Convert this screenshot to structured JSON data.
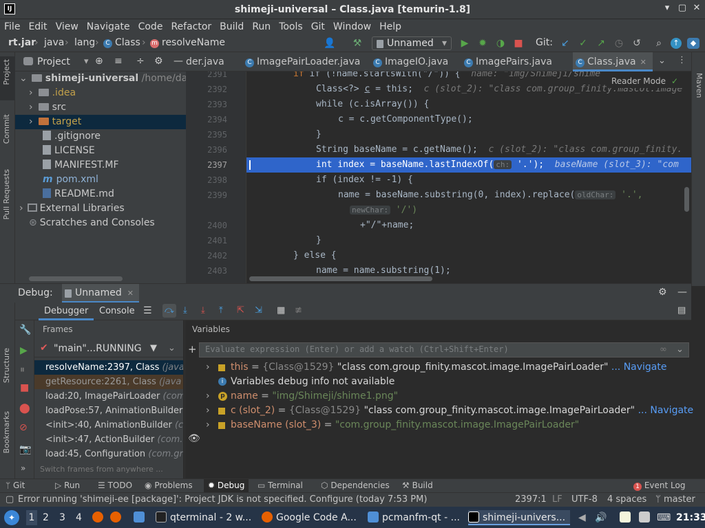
{
  "window": {
    "title": "shimeji-universal – Class.java [temurin-1.8]",
    "app_icon": "IJ"
  },
  "menu": [
    "File",
    "Edit",
    "View",
    "Navigate",
    "Code",
    "Refactor",
    "Build",
    "Run",
    "Tools",
    "Git",
    "Window",
    "Help"
  ],
  "nav": {
    "crumbs": [
      "rt.jar",
      "java",
      "lang",
      "Class",
      "resolveName"
    ],
    "run_config": "Unnamed",
    "git_label": "Git:"
  },
  "side_left": {
    "project": "Project",
    "commit": "Commit",
    "pull": "Pull Requests",
    "structure": "Structure",
    "bookmarks": "Bookmarks"
  },
  "side_right": {
    "maven": "Maven"
  },
  "project_panel": {
    "title": "Project",
    "tree": [
      {
        "label": "shimeji-universal",
        "extra": "/home/dartz",
        "depth": 0,
        "kind": "folder"
      },
      {
        "label": ".idea",
        "depth": 1,
        "kind": "folder"
      },
      {
        "label": "src",
        "depth": 1,
        "kind": "folder"
      },
      {
        "label": "target",
        "depth": 1,
        "kind": "folder"
      },
      {
        "label": ".gitignore",
        "depth": 1,
        "kind": "file"
      },
      {
        "label": "LICENSE",
        "depth": 1,
        "kind": "file"
      },
      {
        "label": "MANIFEST.MF",
        "depth": 1,
        "kind": "file"
      },
      {
        "label": "pom.xml",
        "depth": 1,
        "kind": "file"
      },
      {
        "label": "README.md",
        "depth": 1,
        "kind": "file"
      },
      {
        "label": "External Libraries",
        "depth": 0,
        "kind": "lib"
      },
      {
        "label": "Scratches and Consoles",
        "depth": 0,
        "kind": "scratch"
      }
    ]
  },
  "tabs": [
    "der.java",
    "ImagePairLoader.java",
    "ImageIO.java",
    "ImagePairs.java",
    "Class.java"
  ],
  "editor": {
    "reader_mode": "Reader Mode",
    "lines": [
      "2391",
      "2392",
      "2393",
      "2394",
      "2395",
      "2396",
      "2397",
      "2398",
      "2399",
      "",
      "2400",
      "2401",
      "2402",
      "2403"
    ],
    "code": {
      "l2391": "if (!name.startsWith(\"/\")) {",
      "l2391_hint": "name: \"img/Shimeji/shime",
      "l2392a": "Class<?> ",
      "l2392b": "c",
      "l2392c": " = this;",
      "l2392_hint": "c (slot_2): \"class com.group_finity.mascot.image",
      "l2393": "while (c.isArray()) {",
      "l2394": "c = c.getComponentType();",
      "l2395": "}",
      "l2396": "String baseName = c.getName();",
      "l2396_hint": "c (slot_2): \"class com.group_finity.",
      "l2397a": "int index = baseName.lastIndexOf(",
      "l2397_param": "ch:",
      "l2397b": " '.');",
      "l2397_hint": "baseName (slot_3): \"com",
      "l2398": "if (index != -1) {",
      "l2399a": "name = baseName.substring(0, index).replace(",
      "l2399_param": "oldChar:",
      "l2399b": " '.',",
      "l2399c_param": "newChar:",
      "l2399c": " '/')",
      "l2399d": "+\"/\"+name;",
      "l2401": "}",
      "l2402": "} else {",
      "l2403": "name = name.substring(1);"
    }
  },
  "debug": {
    "label": "Debug:",
    "config": "Unnamed",
    "tab_debugger": "Debugger",
    "tab_console": "Console",
    "frames_title": "Frames",
    "variables_title": "Variables",
    "thread": "\"main\"...RUNNING",
    "frames": [
      {
        "method": "resolveName:2397, Class",
        "loc": "(java"
      },
      {
        "method": "getResource:2261, Class",
        "loc": "(java"
      },
      {
        "method": "load:20, ImagePairLoader",
        "loc": "(com"
      },
      {
        "method": "loadPose:57, AnimationBuilder",
        "loc": ""
      },
      {
        "method": "<init>:40, AnimationBuilder",
        "loc": "(c"
      },
      {
        "method": "<init>:47, ActionBuilder",
        "loc": "(com."
      },
      {
        "method": "load:45, Configuration",
        "loc": "(com.gr"
      }
    ],
    "switch_frames": "Switch frames from anywhere ...",
    "eval_placeholder": "Evaluate expression (Enter) or add a watch (Ctrl+Shift+Enter)",
    "vars": [
      {
        "name": "this",
        "eq": " = ",
        "type": "{Class@1529}",
        "value": " \"class com.group_finity.mascot.image.ImagePairLoader\"",
        "link": "... Navigate"
      },
      {
        "name": "",
        "eq": "",
        "type": "",
        "value": "Variables debug info not available",
        "link": ""
      },
      {
        "name": "name",
        "eq": " = ",
        "type": "",
        "value": "\"img/Shimeji/shime1.png\"",
        "link": ""
      },
      {
        "name": "c (slot_2)",
        "eq": " = ",
        "type": "{Class@1529}",
        "value": " \"class com.group_finity.mascot.image.ImagePairLoader\"",
        "link": "... Navigate"
      },
      {
        "name": "baseName (slot_3)",
        "eq": " = ",
        "type": "",
        "value": "\"com.group_finity.mascot.image.ImagePairLoader\"",
        "link": ""
      }
    ]
  },
  "bottom_tabs": [
    "Git",
    "Run",
    "TODO",
    "Problems",
    "Debug",
    "Terminal",
    "Dependencies",
    "Build"
  ],
  "event_log": {
    "badge": "1",
    "label": "Event Log"
  },
  "status": {
    "message": "Error running 'shimeji-ee [package]': Project JDK is not specified. Configure (today 7:53 PM)",
    "position": "2397:1",
    "line_sep": "LF",
    "encoding": "UTF-8",
    "indent": "4 spaces",
    "branch": "master"
  },
  "taskbar": {
    "workspaces": [
      "1",
      "2",
      "3",
      "4"
    ],
    "tasks": [
      "qterminal - 2 w...",
      "Google Code A...",
      "pcmanfm-qt - ...",
      "shimeji-univers..."
    ],
    "clock": "21:33"
  }
}
